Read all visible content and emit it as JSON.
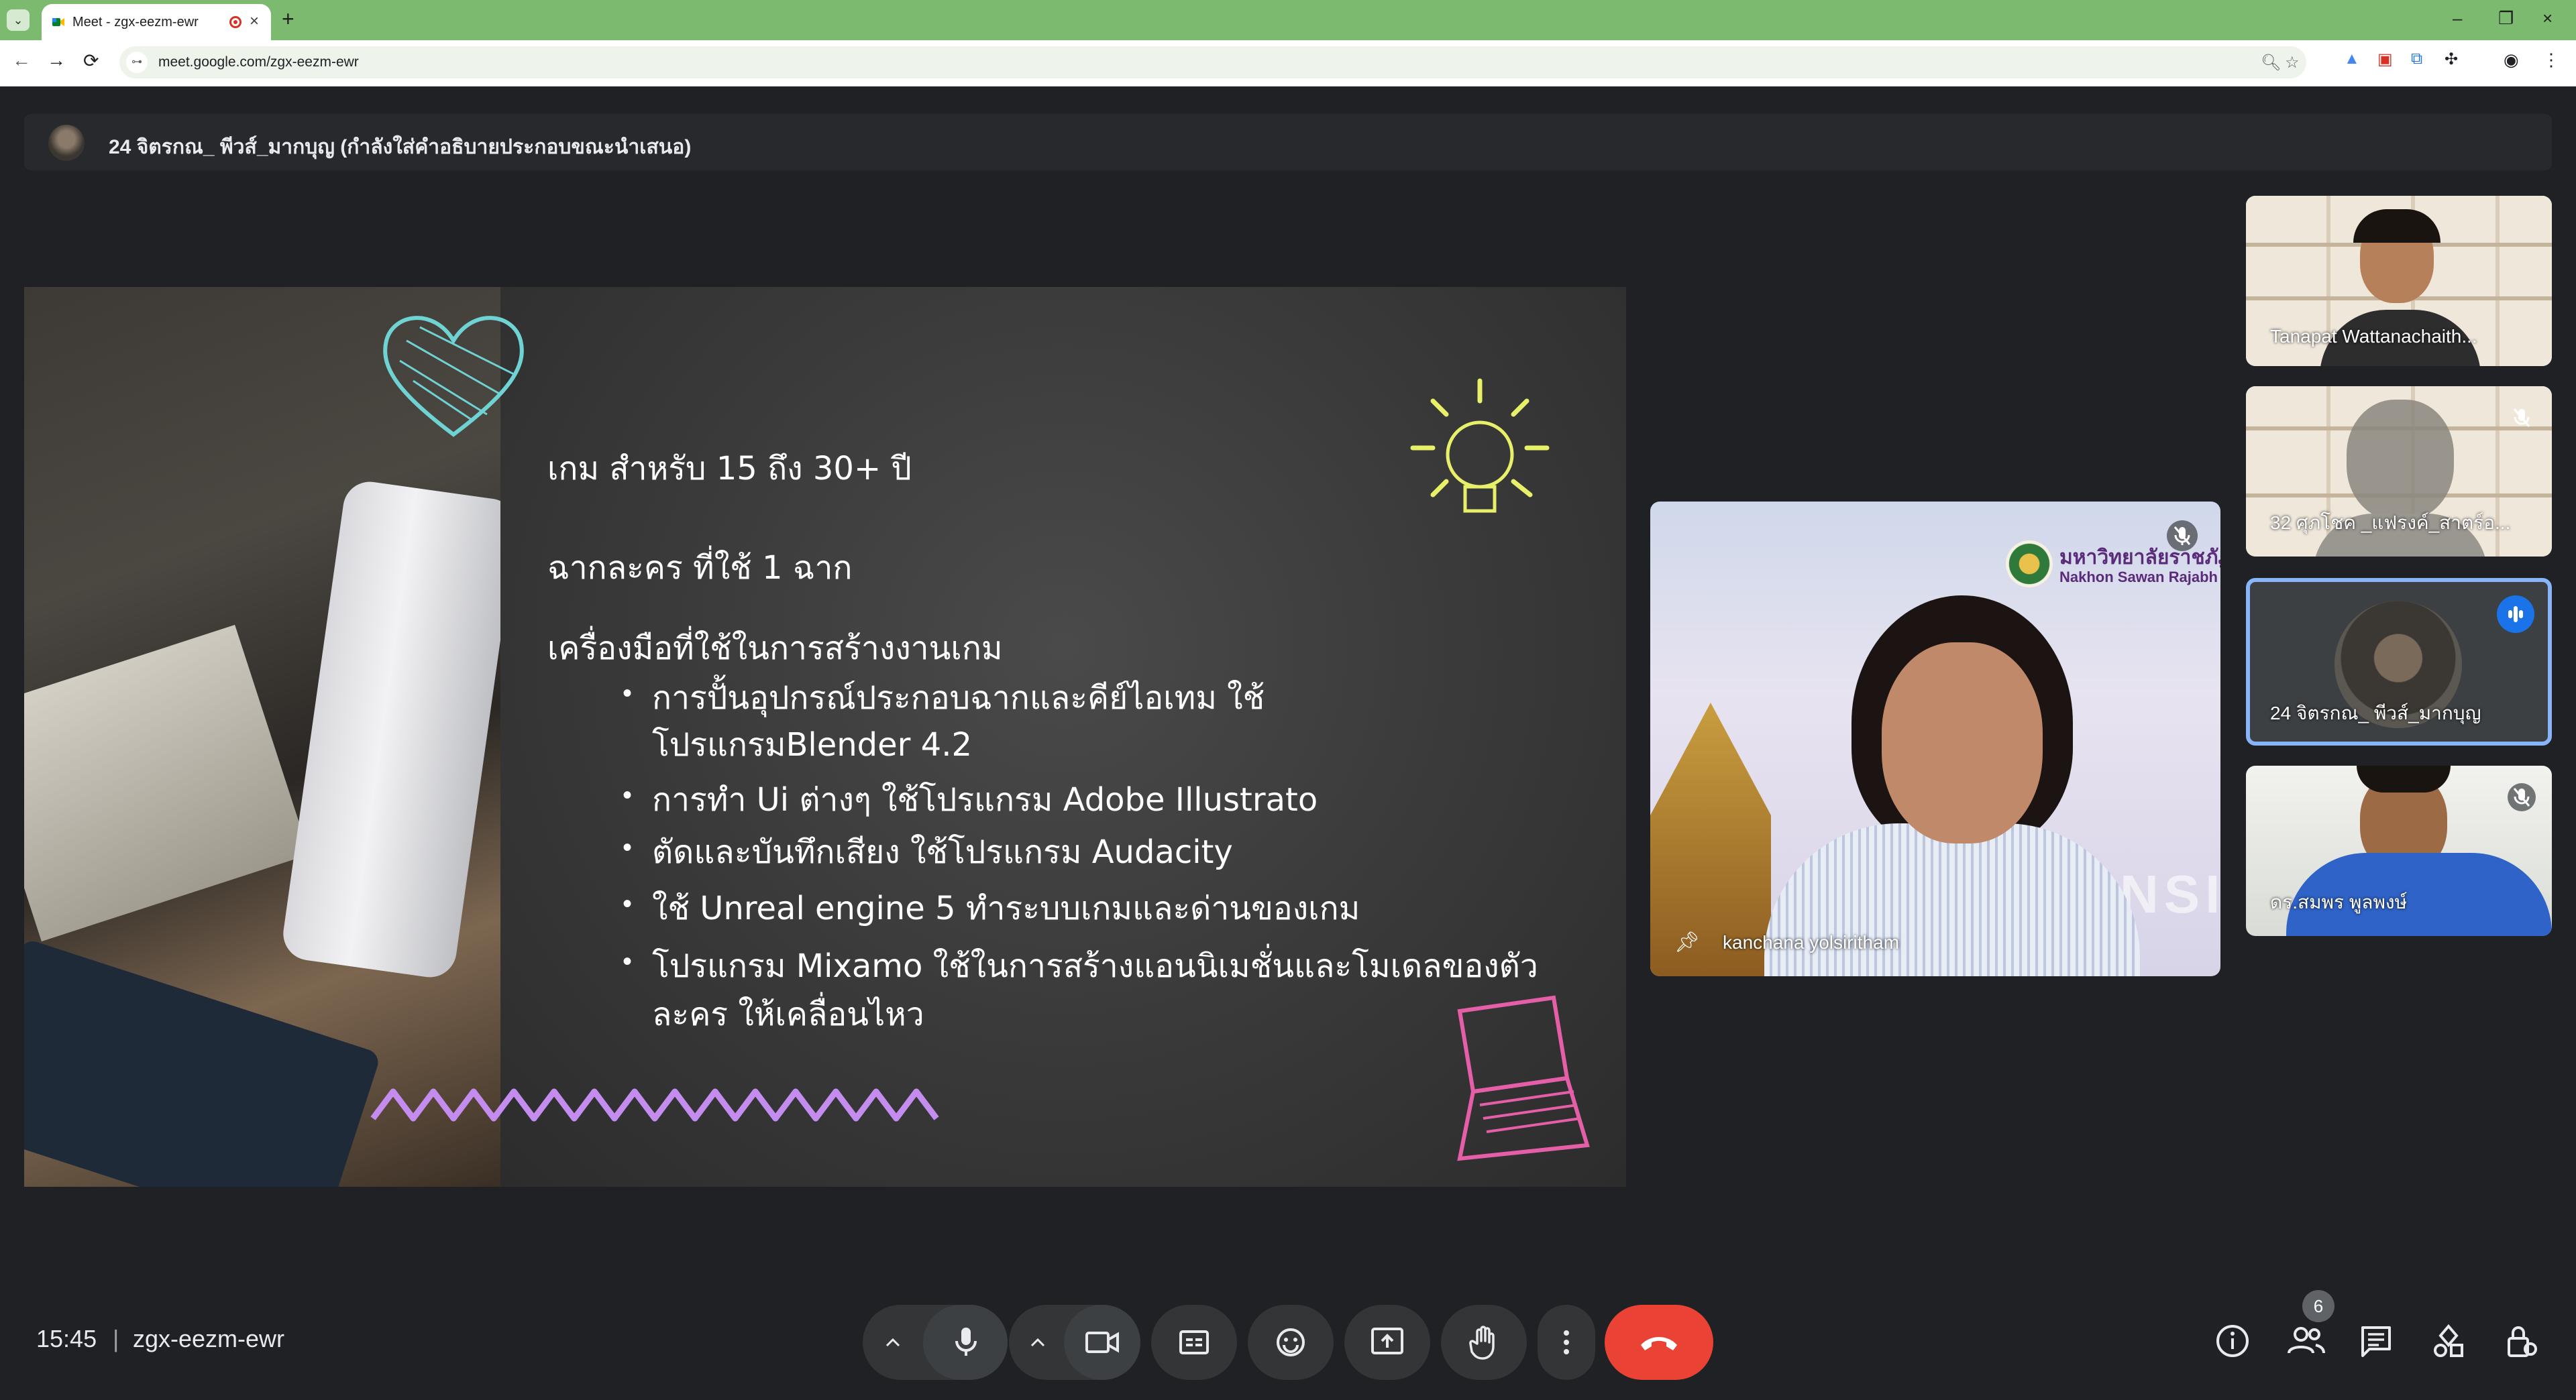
{
  "browser": {
    "tab_title": "Meet - zgx-eezm-ewr",
    "url": "meet.google.com/zgx-eezm-ewr"
  },
  "presenting_bar": {
    "text": "24 จิตรกณ_ พีวส์_มากบุญ (กำลังใส่คำอธิบายประกอบขณะนำเสนอ)"
  },
  "slide": {
    "line1": "เกม สำหรับ 15 ถึง 30+ ปี",
    "line2": "ฉากละคร ที่ใช้ 1 ฉาก",
    "line3": "เครื่องมือที่ใช้ในการสร้างงานเกม",
    "bullets": [
      "การปั้นอุปกรณ์ประกอบฉากและคีย์ไอเทม ใช้",
      "โปรแกรมBlender 4.2",
      "การทำ Ui ต่างๆ ใช้โปรแกรม Adobe Illustrato",
      "ตัดและบันทึกเสียง ใช้โปรแกรม Audacity",
      "ใช้ Unreal engine 5 ทำระบบเกมและด่านของเกม",
      " โปรแกรม Mixamo ใช้ในการสร้างแอนนิเมชั่นและโมเดลของตัว",
      "ละคร ให้เคลื่อนไหว"
    ]
  },
  "featured": {
    "name": "kanchana yolsiritham",
    "logo_th": "มหาวิทยาลัยราชภัฏ",
    "logo_en": "Nakhon Sawan Rajabh",
    "bg_text": "NSI"
  },
  "participants": [
    {
      "name": "Tanapat Wattanachaith..."
    },
    {
      "name": "32 ศุภโชค _แฟรงค์_สาตร์อ..."
    },
    {
      "name": "24 จิตรกณ_ พีวส์_มากบุญ"
    },
    {
      "name": "ดร.สมพร พูลพงษ์"
    }
  ],
  "footer": {
    "time": "15:45",
    "separator": "|",
    "meeting_code": "zgx-eezm-ewr",
    "people_count": "6"
  },
  "colors": {
    "tab_strip": "#7cbb6f",
    "meet_bg": "#202124",
    "end_call": "#ea4335",
    "active_speaker": "#8ab4f8"
  }
}
